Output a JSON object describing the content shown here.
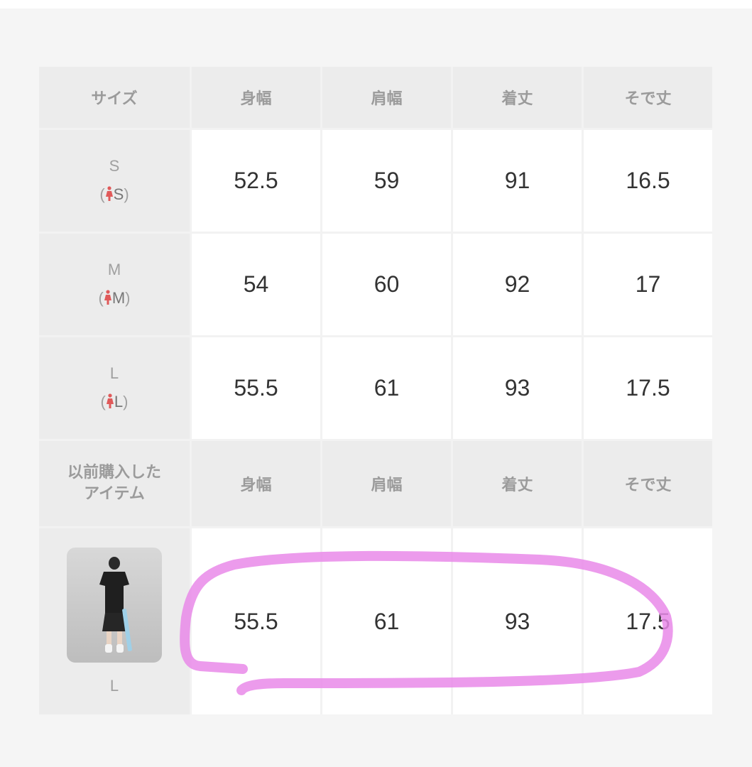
{
  "table": {
    "headers": {
      "size": "サイズ",
      "col1": "身幅",
      "col2": "肩幅",
      "col3": "着丈",
      "col4": "そで丈"
    },
    "rows": [
      {
        "size": "S",
        "sub_open": "(",
        "sub_letter": "S",
        "sub_close": ")",
        "values": [
          "52.5",
          "59",
          "91",
          "16.5"
        ]
      },
      {
        "size": "M",
        "sub_open": "(",
        "sub_letter": "M",
        "sub_close": ")",
        "values": [
          "54",
          "60",
          "92",
          "17"
        ]
      },
      {
        "size": "L",
        "sub_open": "(",
        "sub_letter": "L",
        "sub_close": ")",
        "values": [
          "55.5",
          "61",
          "93",
          "17.5"
        ]
      }
    ],
    "previous": {
      "label_line1": "以前購入した",
      "label_line2": "アイテム",
      "headers": [
        "身幅",
        "肩幅",
        "着丈",
        "そで丈"
      ],
      "item_size": "L",
      "values": [
        "55.5",
        "61",
        "93",
        "17.5"
      ]
    }
  },
  "colors": {
    "header_bg": "#ececec",
    "value_bg": "#ffffff",
    "person_icon": "#e05a5a",
    "highlight_stroke": "#e98ae9"
  },
  "icons": {
    "person": "woman-figure-icon"
  }
}
